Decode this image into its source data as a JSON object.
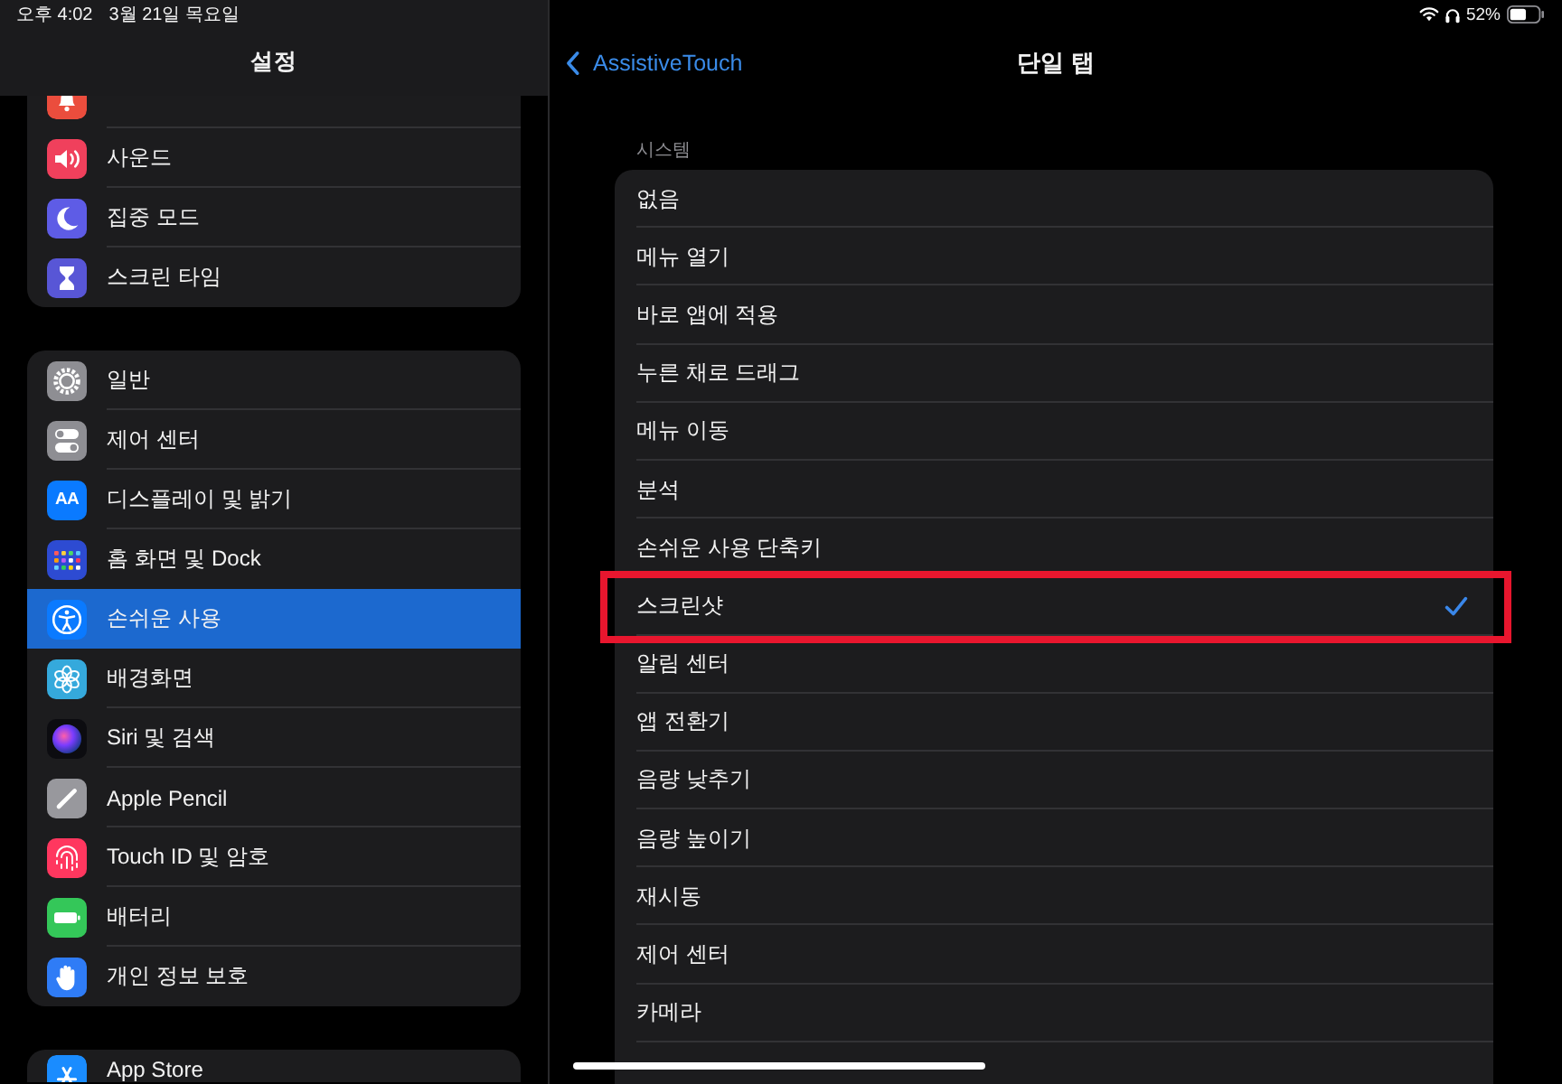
{
  "status_bar": {
    "time": "오후 4:02",
    "date": "3월 21일 목요일",
    "battery": "52%"
  },
  "sidebar": {
    "title": "설정",
    "groups": [
      {
        "items": [
          {
            "kind": "notifications",
            "selected": false
          },
          {
            "kind": "sounds",
            "label": "사운드",
            "selected": false
          },
          {
            "kind": "focus",
            "label": "집중 모드",
            "selected": false
          },
          {
            "kind": "screentime",
            "label": "스크린 타임",
            "selected": false
          }
        ]
      },
      {
        "items": [
          {
            "kind": "general",
            "label": "일반",
            "selected": false
          },
          {
            "kind": "controlcenter",
            "label": "제어 센터",
            "selected": false
          },
          {
            "kind": "display",
            "label": "디스플레이 및 밝기",
            "icon_text": "AA",
            "selected": false
          },
          {
            "kind": "homescreen",
            "label": "홈 화면 및 Dock",
            "selected": false
          },
          {
            "kind": "accessibility",
            "label": "손쉬운 사용",
            "selected": true
          },
          {
            "kind": "wallpaper",
            "label": "배경화면",
            "selected": false
          },
          {
            "kind": "siri",
            "label": "Siri 및 검색",
            "selected": false
          },
          {
            "kind": "pencil",
            "label": "Apple Pencil",
            "selected": false
          },
          {
            "kind": "touchid",
            "label": "Touch ID 및 암호",
            "selected": false
          },
          {
            "kind": "battery",
            "label": "배터리",
            "selected": false
          },
          {
            "kind": "privacy",
            "label": "개인 정보 보호",
            "selected": false
          }
        ]
      },
      {
        "items": [
          {
            "kind": "appstore",
            "label": "App Store",
            "selected": false
          }
        ]
      }
    ]
  },
  "detail": {
    "back": "AssistiveTouch",
    "title": "단일 탭",
    "section": "시스템",
    "options": [
      {
        "label": "없음",
        "selected": false,
        "highlighted": false
      },
      {
        "label": "메뉴 열기",
        "selected": false,
        "highlighted": false
      },
      {
        "label": "바로 앱에 적용",
        "selected": false,
        "highlighted": false
      },
      {
        "label": "누른 채로 드래그",
        "selected": false,
        "highlighted": false
      },
      {
        "label": "메뉴 이동",
        "selected": false,
        "highlighted": false
      },
      {
        "label": "분석",
        "selected": false,
        "highlighted": false
      },
      {
        "label": "손쉬운 사용 단축키",
        "selected": false,
        "highlighted": false
      },
      {
        "label": "스크린샷",
        "selected": true,
        "highlighted": true
      },
      {
        "label": "알림 센터",
        "selected": false,
        "highlighted": false
      },
      {
        "label": "앱 전환기",
        "selected": false,
        "highlighted": false
      },
      {
        "label": "음량 낮추기",
        "selected": false,
        "highlighted": false
      },
      {
        "label": "음량 높이기",
        "selected": false,
        "highlighted": false
      },
      {
        "label": "재시동",
        "selected": false,
        "highlighted": false
      },
      {
        "label": "제어 센터",
        "selected": false,
        "highlighted": false
      },
      {
        "label": "카메라",
        "selected": false,
        "highlighted": false
      }
    ]
  }
}
